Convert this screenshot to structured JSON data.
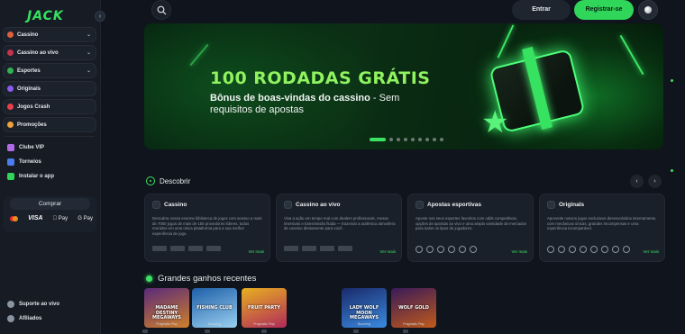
{
  "brand": {
    "logo_text": "JACK",
    "accent": "#2fd65a"
  },
  "sidebar": {
    "collapse_icon": "‹",
    "items": [
      {
        "label": "Cassino",
        "chevron": "⌄",
        "icon_color": "#e05f3c"
      },
      {
        "label": "Cassino ao vivo",
        "chevron": "⌄",
        "icon_color": "#c8324c"
      },
      {
        "label": "Esportes",
        "chevron": "⌄",
        "icon_color": "#2fb34f"
      },
      {
        "label": "Originais",
        "icon_color": "#8a5cf0"
      },
      {
        "label": "Jogos Crash",
        "icon_color": "#e8404a"
      },
      {
        "label": "Promoções",
        "icon_color": "#f0a23a"
      }
    ],
    "extras": [
      {
        "label": "Clube VIP",
        "icon_color": "#b06ae8"
      },
      {
        "label": "Torneios",
        "icon_color": "#4a7ef0"
      },
      {
        "label": "Instalar o app",
        "icon_color": "#2fd65a"
      }
    ],
    "buy_label": "Comprar",
    "payments": [
      "VISA",
      " Pay",
      "G Pay"
    ],
    "bottom": [
      {
        "label": "Suporte ao vivo",
        "icon": "headset-icon"
      },
      {
        "label": "Afiliados",
        "icon": "users-icon"
      }
    ]
  },
  "header": {
    "login_label": "Entrar",
    "register_label": "Registrar-se"
  },
  "banner": {
    "title": "100 RODADAS GRÁTIS",
    "subtitle_bold": "Bônus de boas-vindas do cassino",
    "subtitle_rest": " - Sem requisitos de apostas",
    "slide_count": 9,
    "active_slide": 1
  },
  "discover": {
    "title": "Descobrir",
    "prev_icon": "‹",
    "next_icon": "›",
    "cards": [
      {
        "title": "Cassino",
        "desc": "Descubra nossa enorme biblioteca de jogos com acesso a mais de 7000 jogos de mais de 150 provedores líderes, todos reunidos em uma única plataforma para a sua melhor experiência de jogo.",
        "link": "Ver mais"
      },
      {
        "title": "Cassino ao vivo",
        "desc": "Viva a ação em tempo real com dealers profissionais, mesas imersivas e transmissão fluida — trazendo a autêntica atmosfera de cassino diretamente para você.",
        "link": "Ver mais"
      },
      {
        "title": "Apostas esportivas",
        "desc": "Aposte nos seus esportes favoritos com odds competitivas, opções de apostas ao vivo e uma ampla variedade de mercados para todos os tipos de jogadores.",
        "link": "Ver mais"
      },
      {
        "title": "Originals",
        "desc": "Aproveite nossos jogos exclusivos desenvolvidos internamente, com mecânicas únicas, grandes recompensas e uma experiência incomparável.",
        "link": "Ver mais"
      }
    ]
  },
  "wins": {
    "title": "Grandes ganhos recentes",
    "tiles": [
      {
        "name": "MADAME DESTINY MEGAWAYS",
        "provider": "Pragmatic Play",
        "c1": "#5a2a7a",
        "c2": "#d0802a"
      },
      {
        "name": "FISHING CLUB",
        "provider": "Booming",
        "c1": "#1e5fa8",
        "c2": "#9ad0f0"
      },
      {
        "name": "FRUIT PARTY",
        "provider": "Pragmatic Play",
        "c1": "#e8b020",
        "c2": "#b02a5a"
      },
      {
        "name": "LADY WOLF MOON MEGAWAYS",
        "provider": "Booming",
        "c1": "#1a2a6a",
        "c2": "#3a8ae0"
      },
      {
        "name": "WOLF GOLD",
        "provider": "Pragmatic Play",
        "c1": "#3a1a5a",
        "c2": "#c05a1a"
      }
    ]
  }
}
